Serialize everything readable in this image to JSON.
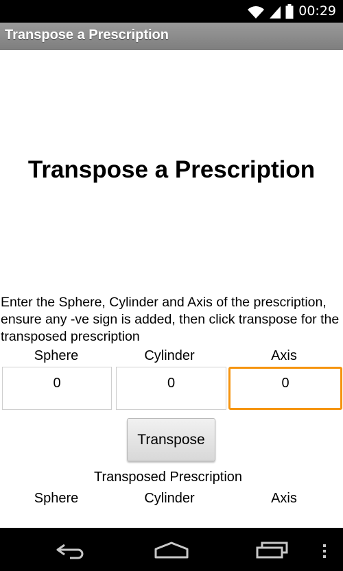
{
  "status_bar": {
    "time": "00:29",
    "icons": [
      "wifi-icon",
      "signal-icon",
      "battery-icon"
    ]
  },
  "app_bar": {
    "title": "Transpose a Prescription"
  },
  "main": {
    "heading": "Transpose a Prescription",
    "instructions": "Enter the Sphere, Cylinder and Axis of the prescription, ensure any -ve sign is added, then click transpose for the transposed prescription",
    "input_labels": {
      "sphere": "Sphere",
      "cylinder": "Cylinder",
      "axis": "Axis"
    },
    "inputs": {
      "sphere": "0",
      "cylinder": "0",
      "axis": "0"
    },
    "transpose_button": "Transpose",
    "result_heading": "Transposed Prescription",
    "result_labels": {
      "sphere": "Sphere",
      "cylinder": "Cylinder",
      "axis": "Axis"
    }
  },
  "nav_bar": {
    "icons": [
      "back-icon",
      "home-icon",
      "recent-apps-icon",
      "overflow-menu-icon"
    ]
  },
  "colors": {
    "focus_accent": "#f5940f",
    "title_bar": "#8a8a8a"
  }
}
